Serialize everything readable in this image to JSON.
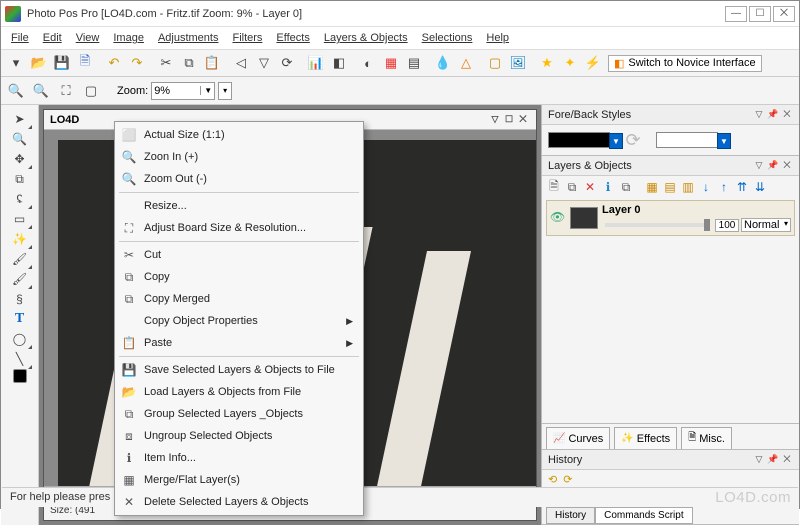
{
  "window": {
    "title": "Photo Pos Pro  [LO4D.com - Fritz.tif Zoom: 9% - Layer 0]"
  },
  "menubar": [
    "File",
    "Edit",
    "View",
    "Image",
    "Adjustments",
    "Filters",
    "Effects",
    "Layers & Objects",
    "Selections",
    "Help"
  ],
  "novice_label": "Switch to Novice Interface",
  "zoom": {
    "label": "Zoom:",
    "value": "9%"
  },
  "doc": {
    "title": "LO4D",
    "status": "Size: (491"
  },
  "panels": {
    "forestyles_title": "Fore/Back Styles",
    "layers_title": "Layers & Objects",
    "layer0": {
      "name": "Layer 0",
      "opacity": "100",
      "blend": "Normal"
    },
    "tabs": [
      "Curves",
      "Effects",
      "Misc."
    ],
    "history_title": "History",
    "history_tabs": [
      "History",
      "Commands Script"
    ]
  },
  "context_menu": {
    "items": [
      {
        "ico": "⬜",
        "label": "Actual Size (1:1)"
      },
      {
        "ico": "🔍",
        "label": "Zoon In (+)"
      },
      {
        "ico": "🔍",
        "label": "Zoom Out (-)"
      },
      {
        "sep": true
      },
      {
        "ico": "",
        "label": "Resize..."
      },
      {
        "ico": "⛶",
        "label": "Adjust Board  Size & Resolution..."
      },
      {
        "sep": true
      },
      {
        "ico": "✂",
        "label": "Cut"
      },
      {
        "ico": "⧉",
        "label": "Copy"
      },
      {
        "ico": "⧉",
        "label": "Copy Merged"
      },
      {
        "ico": "",
        "label": "Copy Object Properties",
        "sub": true
      },
      {
        "ico": "📋",
        "label": "Paste",
        "sub": true
      },
      {
        "sep": true
      },
      {
        "ico": "💾",
        "label": "Save Selected Layers & Objects to File"
      },
      {
        "ico": "📂",
        "label": "Load Layers & Objects from File"
      },
      {
        "ico": "⧉",
        "label": "Group Selected Layers _Objects"
      },
      {
        "ico": "⧈",
        "label": "Ungroup Selected Objects"
      },
      {
        "ico": "ℹ",
        "label": "Item Info..."
      },
      {
        "ico": "▦",
        "label": "Merge/Flat Layer(s)"
      },
      {
        "ico": "✕",
        "label": "Delete Selected Layers & Objects"
      }
    ]
  },
  "statusbar": "For help please pres",
  "watermark": "LO4D.com"
}
